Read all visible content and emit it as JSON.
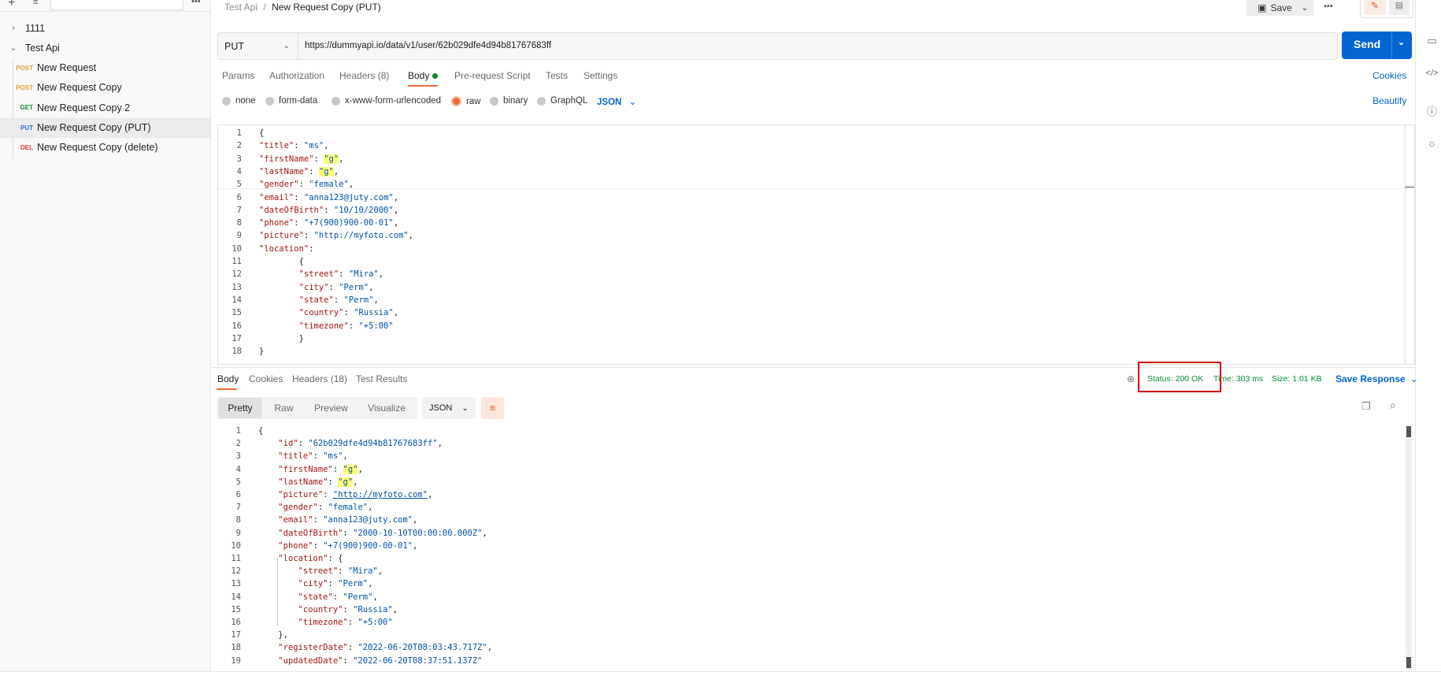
{
  "sidebar": {
    "items": [
      {
        "type": "folder",
        "chev": "›",
        "label": "1111"
      },
      {
        "type": "folder",
        "chev": "⌄",
        "label": "Test Api"
      },
      {
        "type": "request",
        "method": "POST",
        "label": "New Request"
      },
      {
        "type": "request",
        "method": "POST",
        "label": "New Request Copy"
      },
      {
        "type": "request",
        "method": "GET",
        "label": "New Request Copy 2"
      },
      {
        "type": "request",
        "method": "PUT",
        "label": "New Request Copy (PUT)"
      },
      {
        "type": "request",
        "method": "DEL",
        "label": "New Request Copy (delete)"
      }
    ]
  },
  "header": {
    "collection": "Test Api",
    "separator": "/",
    "request_name": "New Request Copy (PUT)",
    "save_label": "Save",
    "more_label": "•••"
  },
  "request": {
    "method": "PUT",
    "url": "https://dummyapi.io/data/v1/user/62b029dfe4d94b81767683ff",
    "send_label": "Send",
    "tabs": [
      "Params",
      "Authorization",
      "Headers (8)",
      "Body",
      "Pre-request Script",
      "Tests",
      "Settings"
    ],
    "cookies_label": "Cookies",
    "body_modes": [
      "none",
      "form-data",
      "x-www-form-urlencoded",
      "raw",
      "binary",
      "GraphQL"
    ],
    "body_format": "JSON",
    "beautify_label": "Beautify"
  },
  "request_body_lines": [
    [
      "1",
      "{"
    ],
    [
      "2",
      "\"title\": \"ms\","
    ],
    [
      "3",
      "\"firstName\": \"g\","
    ],
    [
      "4",
      "\"lastName\": \"g\","
    ],
    [
      "5",
      "\"gender\": \"female\","
    ],
    [
      "6",
      "\"email\": \"anna123@juty.com\","
    ],
    [
      "7",
      "\"dateOfBirth\": \"10/10/2000\","
    ],
    [
      "8",
      "\"phone\": \"+7(900)900-00-01\","
    ],
    [
      "9",
      "\"picture\": \"http://myfoto.com\","
    ],
    [
      "10",
      "\"location\":"
    ],
    [
      "11",
      "        {"
    ],
    [
      "12",
      "        \"street\": \"Mira\","
    ],
    [
      "13",
      "        \"city\": \"Perm\","
    ],
    [
      "14",
      "        \"state\": \"Perm\","
    ],
    [
      "15",
      "        \"country\": \"Russia\","
    ],
    [
      "16",
      "        \"timezone\": \"+5:00\""
    ],
    [
      "17",
      "        }"
    ],
    [
      "18",
      "}"
    ]
  ],
  "response": {
    "tabs": [
      "Body",
      "Cookies",
      "Headers (18)",
      "Test Results"
    ],
    "status": "Status: 200 OK",
    "time": "Time: 303 ms",
    "size": "Size: 1.01 KB",
    "save_response": "Save Response",
    "views": [
      "Pretty",
      "Raw",
      "Preview",
      "Visualize"
    ],
    "format": "JSON"
  },
  "response_body_lines": [
    [
      "1",
      "{"
    ],
    [
      "2",
      "    \"id\": \"62b029dfe4d94b81767683ff\","
    ],
    [
      "3",
      "    \"title\": \"ms\","
    ],
    [
      "4",
      "    \"firstName\": \"g\","
    ],
    [
      "5",
      "    \"lastName\": \"g\","
    ],
    [
      "6",
      "    \"picture\": \"http://myfoto.com\","
    ],
    [
      "7",
      "    \"gender\": \"female\","
    ],
    [
      "8",
      "    \"email\": \"anna123@juty.com\","
    ],
    [
      "9",
      "    \"dateOfBirth\": \"2000-10-10T00:00:00.000Z\","
    ],
    [
      "10",
      "    \"phone\": \"+7(900)900-00-01\","
    ],
    [
      "11",
      "    \"location\": {"
    ],
    [
      "12",
      "        \"street\": \"Mira\","
    ],
    [
      "13",
      "        \"city\": \"Perm\","
    ],
    [
      "14",
      "        \"state\": \"Perm\","
    ],
    [
      "15",
      "        \"country\": \"Russia\","
    ],
    [
      "16",
      "        \"timezone\": \"+5:00\""
    ],
    [
      "17",
      "    },"
    ],
    [
      "18",
      "    \"registerDate\": \"2022-06-20T08:03:43.717Z\","
    ],
    [
      "19",
      "    \"updatedDate\": \"2022-06-20T08:37:51.137Z\""
    ]
  ],
  "colors": {
    "accent": "#0265d2",
    "post": "#e8a03a",
    "get": "#0d8a3a",
    "put": "#2a6fd1",
    "del": "#d93d2f",
    "highlight": "#ffff7a",
    "status_box": "#cc0000"
  }
}
